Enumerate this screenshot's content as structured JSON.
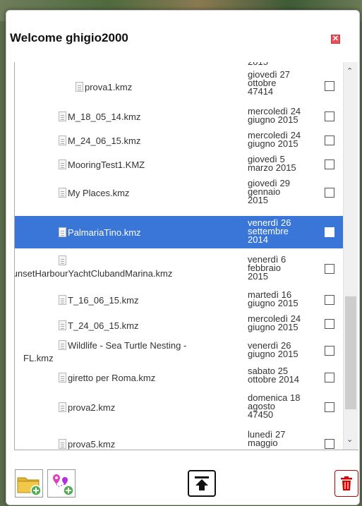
{
  "dialog": {
    "title": "Welcome ghigio2000"
  },
  "close_icon": "close-icon",
  "files": [
    {
      "name": "prova1.kmz",
      "date": [
        "giovedì 27",
        "ottobre",
        "47414"
      ],
      "selected": false
    },
    {
      "name": "M_18_05_14.kmz",
      "date": [
        "mercoledì 24",
        "giugno 2015"
      ],
      "selected": false
    },
    {
      "name": "M_24_06_15.kmz",
      "date": [
        "mercoledì 24",
        "giugno 2015"
      ],
      "selected": false
    },
    {
      "name": "MooringTest1.KMZ",
      "date": [
        "giovedì 5",
        "marzo 2015"
      ],
      "selected": false
    },
    {
      "name": "My Places.kmz",
      "date": [
        "giovedì 29",
        "gennaio",
        "2015"
      ],
      "selected": false
    },
    {
      "name": "PalmariaTino.kmz",
      "date": [
        "venerdì 26",
        "settembre",
        "2014"
      ],
      "selected": true
    },
    {
      "name": "SunsetHarbourYachtClubandMarina.kmz",
      "date": [
        "venerdì 6",
        "febbraio",
        "2015"
      ],
      "selected": false
    },
    {
      "name": "T_16_06_15.kmz",
      "date": [
        "martedì 16",
        "giugno 2015"
      ],
      "selected": false
    },
    {
      "name": "T_24_06_15.kmz",
      "date": [
        "mercoledì 24",
        "giugno 2015"
      ],
      "selected": false
    },
    {
      "name_line1": "Wildlife - Sea Turtle Nesting -",
      "name_line2": "FL.kmz",
      "date": [
        "venerdì 26",
        "giugno 2015"
      ],
      "selected": false
    },
    {
      "name": "giretto per Roma.kmz",
      "date": [
        "sabato 25",
        "ottobre 2014"
      ],
      "selected": false
    },
    {
      "name": "prova2.kmz",
      "date": [
        "domenica 18",
        "agosto",
        "47450"
      ],
      "selected": false
    },
    {
      "name": "prova5.kmz",
      "date": [
        "lunedì 27",
        "maggio"
      ],
      "selected": false
    }
  ],
  "toolbar": {
    "add_folder_icon": "folder-add-icon",
    "add_places_icon": "places-add-icon",
    "upload_icon": "upload-icon",
    "delete_icon": "trash-icon"
  },
  "colors": {
    "selection": "#3a76d8",
    "close": "#e8505a",
    "delete": "#cc0000"
  }
}
